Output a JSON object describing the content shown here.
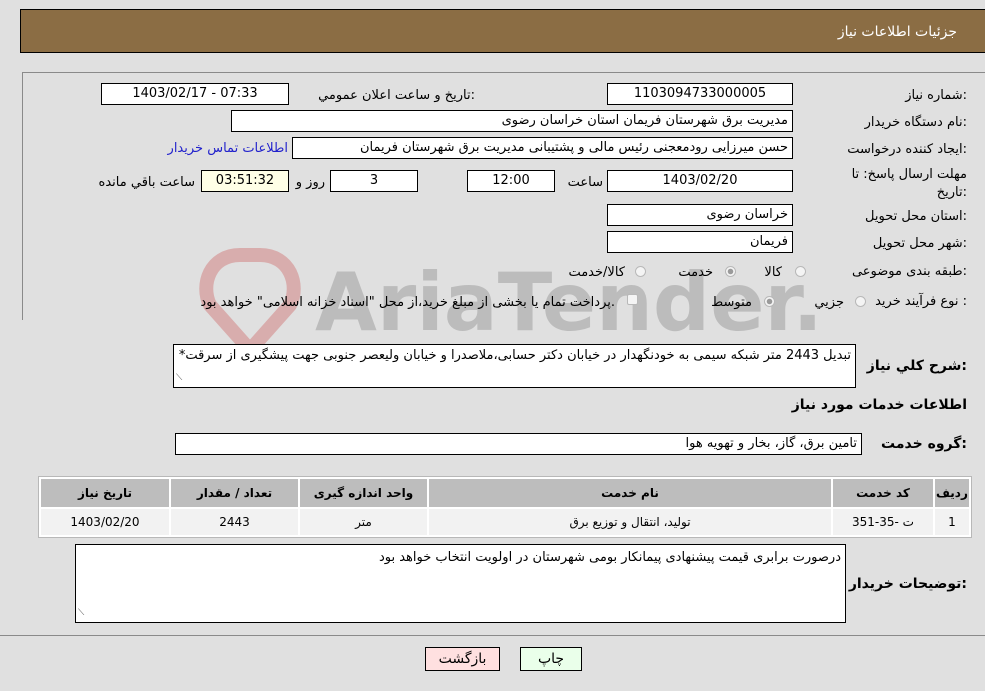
{
  "header": {
    "title": "جزئیات اطلاعات نیاز"
  },
  "form": {
    "need_number": {
      "label": "شماره نیاز:",
      "value": "1103094733000005"
    },
    "announce_datetime": {
      "label": "تاریخ و ساعت اعلان عمومي:",
      "value": "1403/02/17 - 07:33"
    },
    "buyer_org": {
      "label": "نام دستگاه خریدار:",
      "value": "مدیریت برق شهرستان فریمان استان خراسان رضوی"
    },
    "requester": {
      "label": "ایجاد کننده درخواست:",
      "value": "حسن میرزایی رودمعجنی رئیس مالی و پشتیبانی مدیریت برق شهرستان فریمان",
      "contact_link": "اطلاعات تماس خریدار"
    },
    "deadline": {
      "label": "مهلت ارسال پاسخ: تا تاریخ:",
      "date": "1403/02/20",
      "time_label": "ساعت",
      "time": "12:00",
      "days": "3",
      "days_label": "روز و",
      "remaining": "03:51:32",
      "remaining_label": "ساعت باقي مانده"
    },
    "delivery_province": {
      "label": "استان محل تحویل:",
      "value": "خراسان رضوی"
    },
    "delivery_city": {
      "label": "شهر محل تحویل:",
      "value": "فریمان"
    },
    "category": {
      "label": "طبقه بندی موضوعی:",
      "options": [
        {
          "label": "کالا",
          "checked": false
        },
        {
          "label": "خدمت",
          "checked": true
        },
        {
          "label": "کالا/خدمت",
          "checked": false
        }
      ]
    },
    "purchase_process": {
      "label": "نوع فرآیند خرید :",
      "options": [
        {
          "label": "جزیي",
          "checked": false
        },
        {
          "label": "متوسط",
          "checked": true
        }
      ],
      "treasury_note": "پرداخت تمام یا بخشی از مبلغ خرید،از محل \"اسناد خزانه اسلامی\" خواهد بود.",
      "treasury_checked": false
    }
  },
  "description": {
    "label": "شرح کلي نیاز:",
    "value": "تبدیل 2443 متر شبکه سیمی به خودنگهدار در خیابان دکتر حسابی،ملاصدرا و خیابان ولیعصر جنوبی جهت پیشگیری از سرقت*"
  },
  "services": {
    "section_title": "اطلاعات خدمات مورد نیاز",
    "group_label": "گروه خدمت:",
    "group_value": "تامین برق، گاز، بخار و تهویه هوا",
    "table": {
      "headers": [
        "ردیف",
        "کد خدمت",
        "نام خدمت",
        "واحد اندازه گیری",
        "تعداد / مقدار",
        "تاریخ نیاز"
      ],
      "rows": [
        [
          "1",
          "ت -35-351",
          "تولید، انتقال و توزیع برق",
          "متر",
          "2443",
          "1403/02/20"
        ]
      ]
    }
  },
  "buyer_notes": {
    "label": "توضیحات خریدار:",
    "value": "درصورت برابری قیمت پیشنهادی پیمانکار بومی شهرستان در اولویت انتخاب خواهد بود"
  },
  "buttons": {
    "print": "چاپ",
    "back": "بازگشت"
  },
  "watermark": {
    "text": "AriaTender.neT"
  },
  "colors": {
    "header_bg": "#8b6d44",
    "print_bg": "#eaffea",
    "back_bg": "#ffe0e0",
    "link": "#2222cc"
  }
}
